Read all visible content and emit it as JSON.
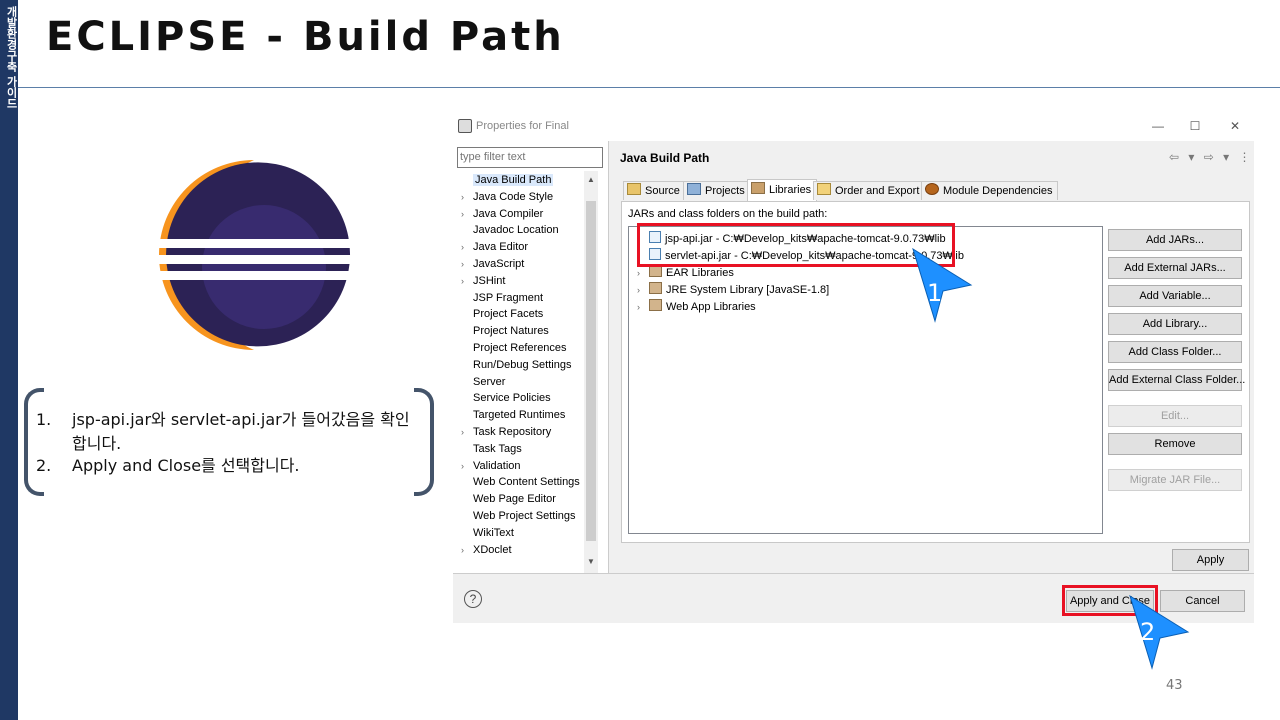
{
  "slide": {
    "side_label": "개발환경구축 가이드",
    "title": "ECLIPSE - Build Path",
    "page_number": "43"
  },
  "notes": [
    {
      "num": "1.",
      "text": "jsp-api.jar와 servlet-api.jar가 들어갔음을 확인합니다."
    },
    {
      "num": "2.",
      "text": "Apply and Close를 선택합니다."
    }
  ],
  "colors": {
    "sidebar": "#1f3864",
    "highlight": "#e81123",
    "eclipse_dark": "#2c2255",
    "eclipse_orange": "#f7941e",
    "cursor_blue": "#1e90ff"
  },
  "dialog": {
    "title": "Properties for Final",
    "window_buttons": [
      "—",
      "☐",
      "✕"
    ],
    "filter_placeholder": "type filter text",
    "tree_items": [
      {
        "label": "Java Build Path",
        "expandable": false,
        "selected": true
      },
      {
        "label": "Java Code Style",
        "expandable": true
      },
      {
        "label": "Java Compiler",
        "expandable": true
      },
      {
        "label": "Javadoc Location",
        "expandable": false
      },
      {
        "label": "Java Editor",
        "expandable": true
      },
      {
        "label": "JavaScript",
        "expandable": true
      },
      {
        "label": "JSHint",
        "expandable": true
      },
      {
        "label": "JSP Fragment",
        "expandable": false
      },
      {
        "label": "Project Facets",
        "expandable": false
      },
      {
        "label": "Project Natures",
        "expandable": false
      },
      {
        "label": "Project References",
        "expandable": false
      },
      {
        "label": "Run/Debug Settings",
        "expandable": false
      },
      {
        "label": "Server",
        "expandable": false
      },
      {
        "label": "Service Policies",
        "expandable": false
      },
      {
        "label": "Targeted Runtimes",
        "expandable": false
      },
      {
        "label": "Task Repository",
        "expandable": true
      },
      {
        "label": "Task Tags",
        "expandable": false
      },
      {
        "label": "Validation",
        "expandable": true
      },
      {
        "label": "Web Content Settings",
        "expandable": false
      },
      {
        "label": "Web Page Editor",
        "expandable": false
      },
      {
        "label": "Web Project Settings",
        "expandable": false
      },
      {
        "label": "WikiText",
        "expandable": false
      },
      {
        "label": "XDoclet",
        "expandable": true
      }
    ],
    "panel_title": "Java Build Path",
    "nav_icons": "⇦ ▾ ⇨ ▾ ⋮",
    "tabs": [
      {
        "label": "Source",
        "active": false,
        "icon": "source-folder-icon"
      },
      {
        "label": "Projects",
        "active": false,
        "icon": "projects-icon"
      },
      {
        "label": "Libraries",
        "active": true,
        "icon": "libraries-icon"
      },
      {
        "label": "Order and Export",
        "active": false,
        "icon": "order-export-icon"
      },
      {
        "label": "Module Dependencies",
        "active": false,
        "icon": "module-dependencies-icon"
      }
    ],
    "jars_label": "JARs and class folders on the build path:",
    "jar_items": [
      {
        "label": "jsp-api.jar - C:₩Develop_kits₩apache-tomcat-9.0.73₩lib",
        "kind": "jar",
        "expandable": false
      },
      {
        "label": "servlet-api.jar - C:₩Develop_kits₩apache-tomcat-9.0.73₩lib",
        "kind": "jar",
        "expandable": false
      },
      {
        "label": "EAR Libraries",
        "kind": "library",
        "expandable": true
      },
      {
        "label": "JRE System Library [JavaSE-1.8]",
        "kind": "library",
        "expandable": true
      },
      {
        "label": "Web App Libraries",
        "kind": "library",
        "expandable": true
      }
    ],
    "side_buttons": [
      {
        "label": "Add JARs...",
        "enabled": true
      },
      {
        "label": "Add External JARs...",
        "enabled": true
      },
      {
        "label": "Add Variable...",
        "enabled": true
      },
      {
        "label": "Add Library...",
        "enabled": true
      },
      {
        "label": "Add Class Folder...",
        "enabled": true
      },
      {
        "label": "Add External Class Folder...",
        "enabled": true
      },
      {
        "label": "Edit...",
        "enabled": false
      },
      {
        "label": "Remove",
        "enabled": true
      },
      {
        "label": "Migrate JAR File...",
        "enabled": false
      }
    ],
    "apply_label": "Apply",
    "apply_close_label": "Apply and Close",
    "cancel_label": "Cancel",
    "help_icon": "help-icon"
  },
  "callouts": [
    {
      "number": "1"
    },
    {
      "number": "2"
    }
  ]
}
